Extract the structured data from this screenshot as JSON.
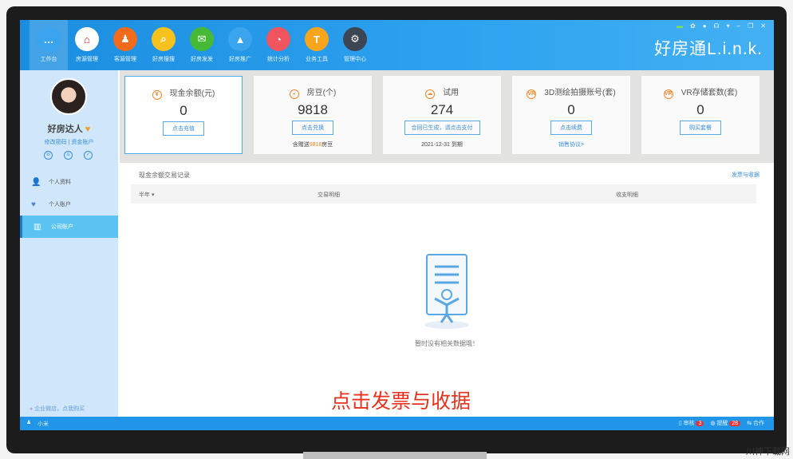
{
  "nav": [
    {
      "label": "工作台",
      "color": "#3aa4ee",
      "glyph": "…"
    },
    {
      "label": "房源管理",
      "color": "#ffffff",
      "glyph": "⌂"
    },
    {
      "label": "客源管理",
      "color": "#f26a1b",
      "glyph": "♟"
    },
    {
      "label": "好房搜搜",
      "color": "#f7c21d",
      "glyph": "⌕"
    },
    {
      "label": "好房发发",
      "color": "#46b936",
      "glyph": "✉"
    },
    {
      "label": "好房推广",
      "color": "#3aa4ee",
      "glyph": "▲"
    },
    {
      "label": "统计分析",
      "color": "#f0545e",
      "glyph": "◔"
    },
    {
      "label": "业务工具",
      "color": "#f9a51c",
      "glyph": "T"
    },
    {
      "label": "管理中心",
      "color": "#3d4552",
      "glyph": "⚙"
    }
  ],
  "window": {
    "brand": "好房通L.i.n.k."
  },
  "user": {
    "name": "好房达人",
    "change_password": "修改密码",
    "fund_account": "资金账户"
  },
  "menu": [
    {
      "label": "个人资料",
      "icon": "👤"
    },
    {
      "label": "个人账户",
      "icon": "♥"
    },
    {
      "label": "公司账户",
      "icon": "▥"
    }
  ],
  "shop_link": "企业微店，点我购买",
  "cards": [
    {
      "title": "现金余额(元)",
      "value": "0",
      "button": "点击充值"
    },
    {
      "title": "房豆(个)",
      "value": "9818",
      "button": "点击兑换",
      "note_pre": "含赠送",
      "note_hl": "9818",
      "note_post": "房豆"
    },
    {
      "title": "试用",
      "value": "274",
      "button": "合同已生成，请点击支付",
      "note": "2021-12-31 到期"
    },
    {
      "title": "3D测绘拍摄账号(套)",
      "value": "0",
      "button": "点击续费",
      "link": "销售协议>"
    },
    {
      "title": "VR存储套数(套)",
      "value": "0",
      "button": "购买套餐"
    }
  ],
  "panel": {
    "title": "现金余额交易记录",
    "link": "发票与收据",
    "filter": "半年 ▾",
    "col1": "交易明细",
    "col2": "收支明细",
    "empty": "暂时没有相关数据哦！"
  },
  "caption": "点击发票与收据",
  "status": {
    "user": "小米",
    "audit": "审核",
    "audit_count": "3",
    "remind": "提醒",
    "remind_count": "28",
    "coop": "合作"
  },
  "watermark": "川神下载网"
}
